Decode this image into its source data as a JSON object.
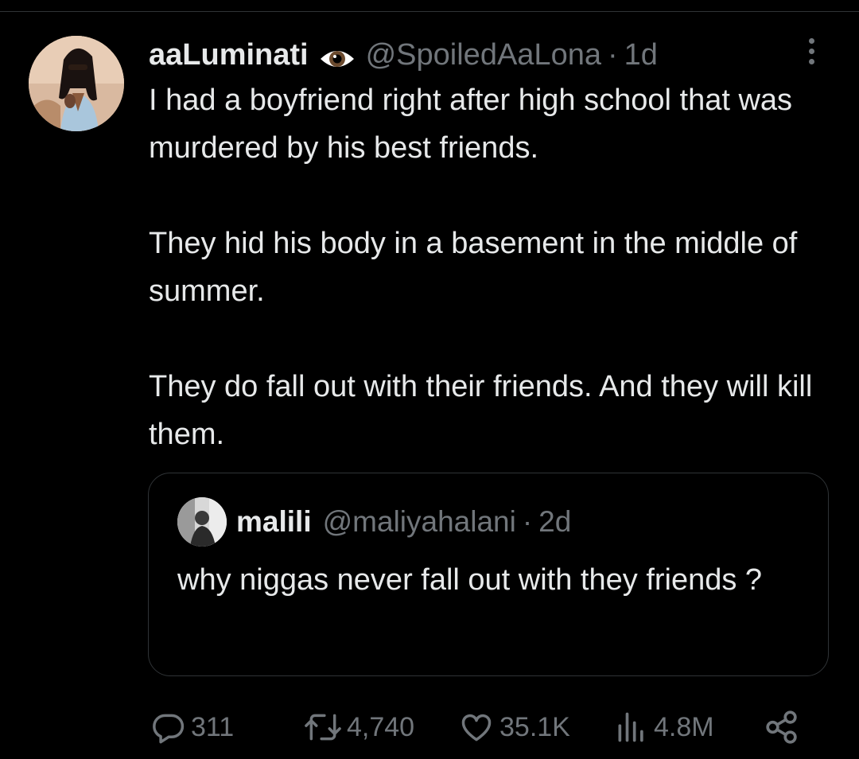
{
  "tweet": {
    "display_name": "aaLuminati",
    "badge_icon": "eye-icon",
    "handle": "@SpoiledAaLona",
    "separator": "·",
    "time": "1d",
    "more_icon": "more-vertical-icon",
    "paragraphs": [
      "I had a boyfriend right after high school that was murdered by his best friends.",
      "They hid his body in a basement in the middle of summer.",
      "They do fall out with their friends. And they will kill them."
    ]
  },
  "quote": {
    "display_name": "malili",
    "handle": "@maliyahalani",
    "separator": "·",
    "time": "2d",
    "text": "why niggas never fall out with they friends ?"
  },
  "actions": {
    "reply": {
      "icon": "reply-icon",
      "count": "311"
    },
    "retweet": {
      "icon": "retweet-icon",
      "count": "4,740"
    },
    "like": {
      "icon": "heart-icon",
      "count": "35.1K"
    },
    "views": {
      "icon": "views-chart-icon",
      "count": "4.8M"
    },
    "share": {
      "icon": "share-icon"
    }
  },
  "colors": {
    "background": "#000000",
    "text_primary": "#e7e9ea",
    "text_secondary": "#71767b",
    "border": "#2f3336"
  }
}
